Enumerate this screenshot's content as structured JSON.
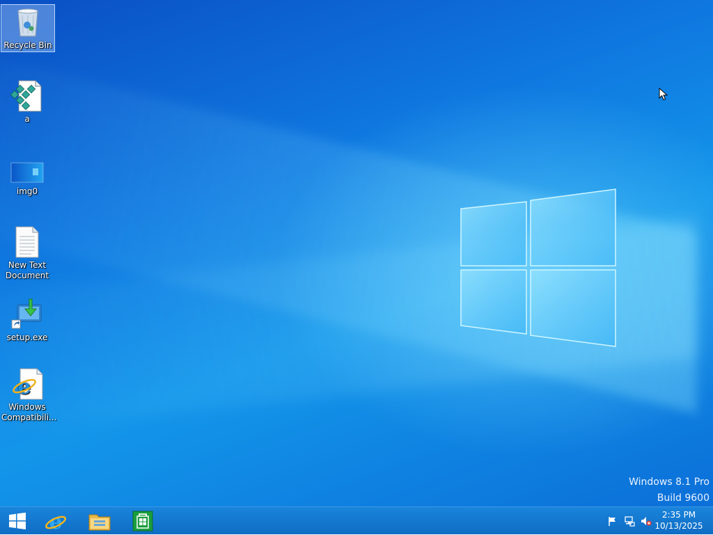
{
  "desktop": {
    "icons": [
      {
        "label": "Recycle Bin",
        "icon": "recycle-bin-icon"
      },
      {
        "label": "a",
        "icon": "script-file-icon"
      },
      {
        "label": "img0",
        "icon": "image-file-icon"
      },
      {
        "label": "New Text Document",
        "icon": "text-document-icon"
      },
      {
        "label": "setup.exe",
        "icon": "installer-shortcut-icon"
      },
      {
        "label": "Windows Compatibili...",
        "icon": "internet-explorer-file-icon"
      }
    ],
    "watermark": {
      "line1": "Windows 8.1 Pro",
      "line2": "Build 9600"
    },
    "background_color": "#0f78e0"
  },
  "taskbar": {
    "pinned": [
      {
        "name": "start",
        "icon": "windows-start-icon"
      },
      {
        "name": "internet-explorer",
        "icon": "internet-explorer-icon"
      },
      {
        "name": "file-explorer",
        "icon": "file-explorer-icon"
      },
      {
        "name": "store",
        "icon": "windows-store-icon"
      }
    ],
    "tray": {
      "icons": [
        "action-center-flag-icon",
        "network-icon",
        "volume-muted-icon"
      ],
      "time": "2:35 PM",
      "date": "10/13/2025"
    },
    "color": "#1277d0"
  }
}
